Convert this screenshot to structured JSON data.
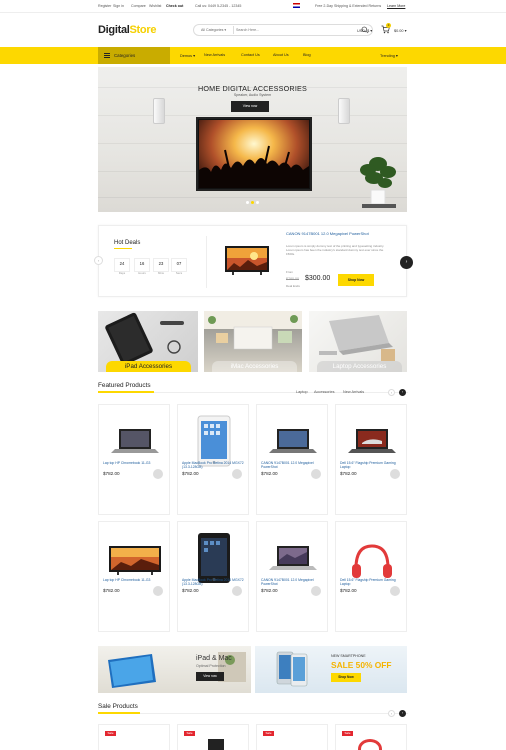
{
  "topbar": {
    "account": "Register",
    "signin": "Sign in",
    "compare": "Compare",
    "wishlist": "Wishlist",
    "checkout": "Check out",
    "call": "Call us: 0449 5-2345 - 12345",
    "shipping": "Free 2-Day Shipping & Extended Returns",
    "learn_more": "Learn More"
  },
  "header": {
    "logo_main": "Digital",
    "logo_accent": "Store",
    "search_category": "All Categories",
    "search_placeholder": "Search Here...",
    "currency": "USD, $",
    "cart_count": "0",
    "cart_total": "$0.00"
  },
  "nav": {
    "categories": "Categories",
    "items": [
      "Demos",
      "New Arrivals",
      "Contact Us",
      "About Us",
      "Blog"
    ],
    "trending": "Trending"
  },
  "slider": {
    "title": "HOME DIGITAL ACCESSORIES",
    "subtitle": "Speaker, Audio System",
    "button": "View now"
  },
  "hot_deals": {
    "title": "Hot Deals",
    "countdown": [
      {
        "value": "24",
        "label": "Days"
      },
      {
        "value": "16",
        "label": "Hours"
      },
      {
        "value": "23",
        "label": "Mins"
      },
      {
        "value": "07",
        "label": "Secs"
      }
    ],
    "product_name": "CANON 9147B001 12.0 Megapixel PowerShot",
    "description": "Lorem ipsum is simply dummy text of the printing and typesetting industry. Lorem ipsum has been the industry's standard dummy text ever since the 1500s.",
    "from": "From",
    "old_price": "$780.00",
    "price": "$300.00",
    "ends": "Deal Ends",
    "button": "Shop Now"
  },
  "category_tiles": [
    "iPad Accessories",
    "iMac Accessories",
    "Laptop Accessories"
  ],
  "featured": {
    "title": "Featured Products",
    "tabs": [
      "Laptop",
      "Accessories",
      "New Arrivals"
    ],
    "products": [
      {
        "name": "Lap top HP Chromebook 11-G3",
        "price": "$782.00",
        "icon": "chromebook"
      },
      {
        "name": "Apple MacBook Pro Retina 2014 MGX72 (13.3-128GB)",
        "price": "$782.00",
        "icon": "ipad-white"
      },
      {
        "name": "CANON 9147B001 12.0 Megapixel PowerShot",
        "price": "$782.00",
        "icon": "laptop-dark"
      },
      {
        "name": "Dell 15.6\" Flagship Premium Gaming Laptop",
        "price": "$782.00",
        "icon": "laptop-car"
      },
      {
        "name": "Lap top HP Chromebook 11-G3",
        "price": "$782.00",
        "icon": "tv"
      },
      {
        "name": "Apple MacBook Pro Retina 2014 MGX72 (13.3-128GB)",
        "price": "$782.00",
        "icon": "ipad-black"
      },
      {
        "name": "CANON 9147B001 12.0 Megapixel PowerShot",
        "price": "$782.00",
        "icon": "laptop-landscape"
      },
      {
        "name": "Dell 15.6\" Flagship Premium Gaming Laptop",
        "price": "$782.00",
        "icon": "headphones"
      }
    ]
  },
  "banners": {
    "left_title": "iPad & Mac",
    "left_sub": "Optimal Protection",
    "left_button": "View now",
    "right_kicker": "NEW SMARTPHONE",
    "right_title": "SALE 50% OFF",
    "right_button": "Shop Now"
  },
  "sale": {
    "title": "Sale Products",
    "badge": "Sale"
  },
  "colors": {
    "accent": "#fdd800",
    "accent_dark": "#c9ac00",
    "link": "#1a5a9a",
    "sale": "#e3262f"
  }
}
